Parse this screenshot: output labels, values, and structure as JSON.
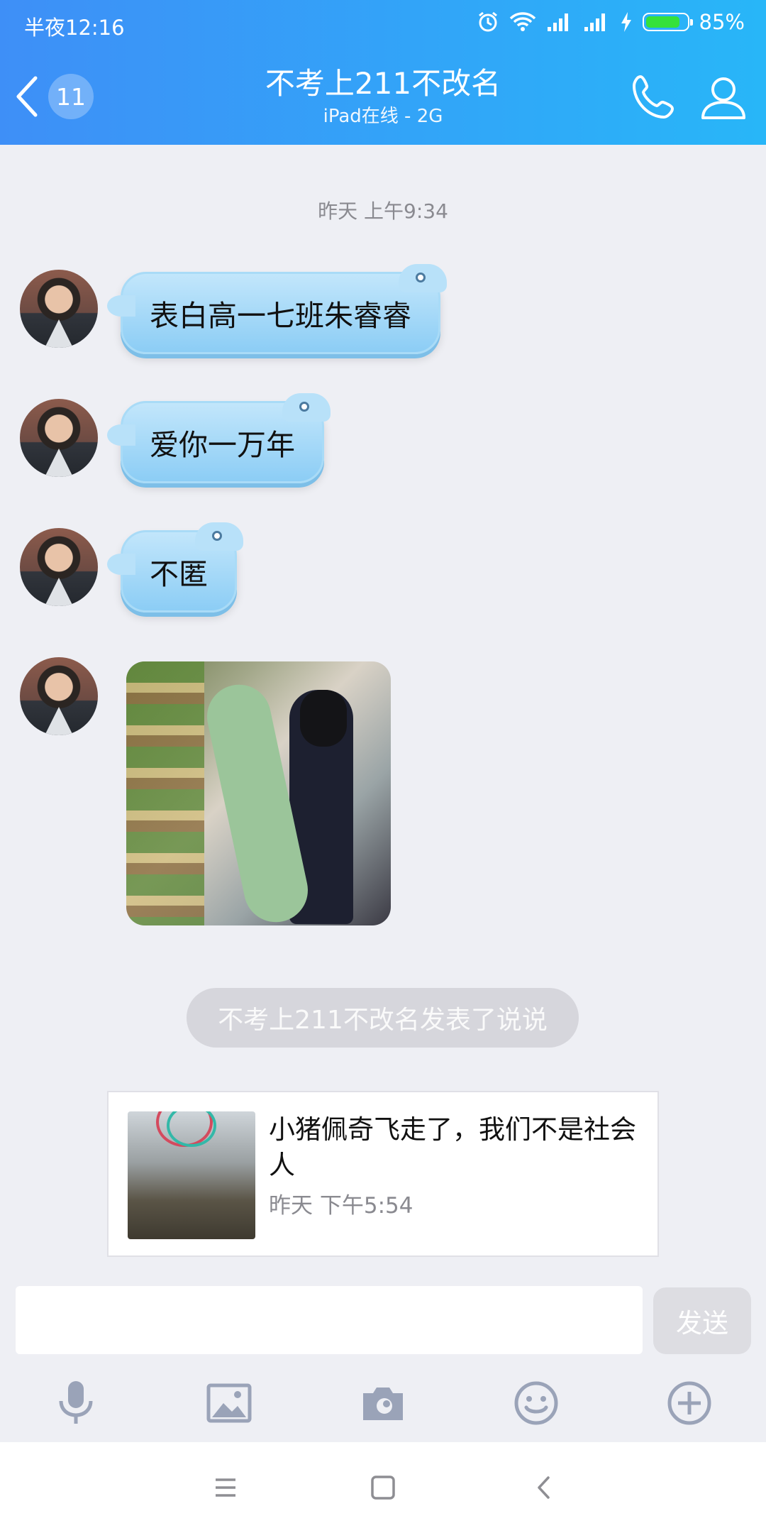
{
  "status_bar": {
    "time": "半夜12:16",
    "battery_percent_text": "85%",
    "battery_level": 0.85,
    "icons": [
      "alarm-icon",
      "wifi-icon",
      "signal-icon",
      "signal-icon",
      "charging-icon",
      "battery-icon"
    ]
  },
  "header": {
    "unread_count": "11",
    "title": "不考上211不改名",
    "subtitle": "iPad在线 - 2G",
    "actions": [
      "phone-icon",
      "profile-icon"
    ]
  },
  "chat": {
    "timestamp": "昨天 上午9:34",
    "messages": [
      {
        "type": "text",
        "text": "表白高一七班朱睿睿"
      },
      {
        "type": "text",
        "text": "爱你一万年"
      },
      {
        "type": "text",
        "text": "不匿"
      },
      {
        "type": "image"
      }
    ],
    "notice": "不考上211不改名发表了说说",
    "feed_card": {
      "text": "小猪佩奇飞走了，我们不是社会人",
      "time": "昨天 下午5:54"
    }
  },
  "input": {
    "placeholder": "",
    "send_label": "发送"
  },
  "toolbar": {
    "items": [
      "microphone-icon",
      "image-icon",
      "camera-icon",
      "emoji-icon",
      "plus-icon"
    ]
  },
  "navbar": {
    "items": [
      "menu-icon",
      "home-icon",
      "back-icon"
    ]
  },
  "colors": {
    "header_gradient_start": "#3e8ff7",
    "header_gradient_end": "#28b6f8",
    "bubble": "#a8daf7",
    "background": "#eeeff4",
    "toolbar_icon": "#9aa3b8"
  }
}
